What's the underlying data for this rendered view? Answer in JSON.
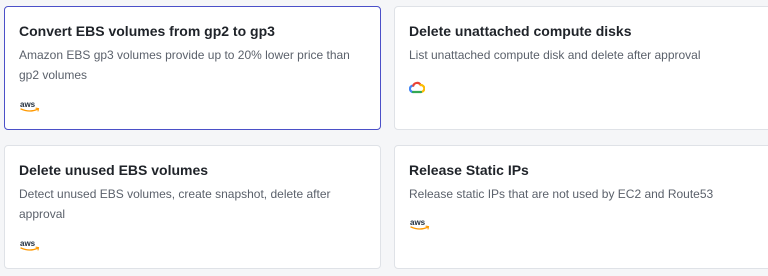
{
  "cards": [
    {
      "title": "Convert EBS volumes from gp2 to gp3",
      "description": "Amazon EBS gp3 volumes provide up to 20% lower price than gp2 volumes",
      "provider_icon": "aws-logo-icon",
      "selected": true
    },
    {
      "title": "Delete unattached compute disks",
      "description": "List unattached compute disk and delete after approval",
      "provider_icon": "google-cloud-logo-icon",
      "selected": false
    },
    {
      "title": "Delete unused EBS volumes",
      "description": "Detect unused EBS volumes, create snapshot, delete after approval",
      "provider_icon": "aws-logo-icon",
      "selected": false
    },
    {
      "title": "Release Static IPs",
      "description": "Release static IPs that are not used by EC2 and Route53",
      "provider_icon": "aws-logo-icon",
      "selected": false
    }
  ],
  "colors": {
    "selected_border": "#4b50c8",
    "aws_orange": "#ff9900",
    "gcp_blue": "#4285f4",
    "gcp_red": "#ea4335",
    "gcp_yellow": "#fbbc04",
    "gcp_green": "#34a853"
  }
}
